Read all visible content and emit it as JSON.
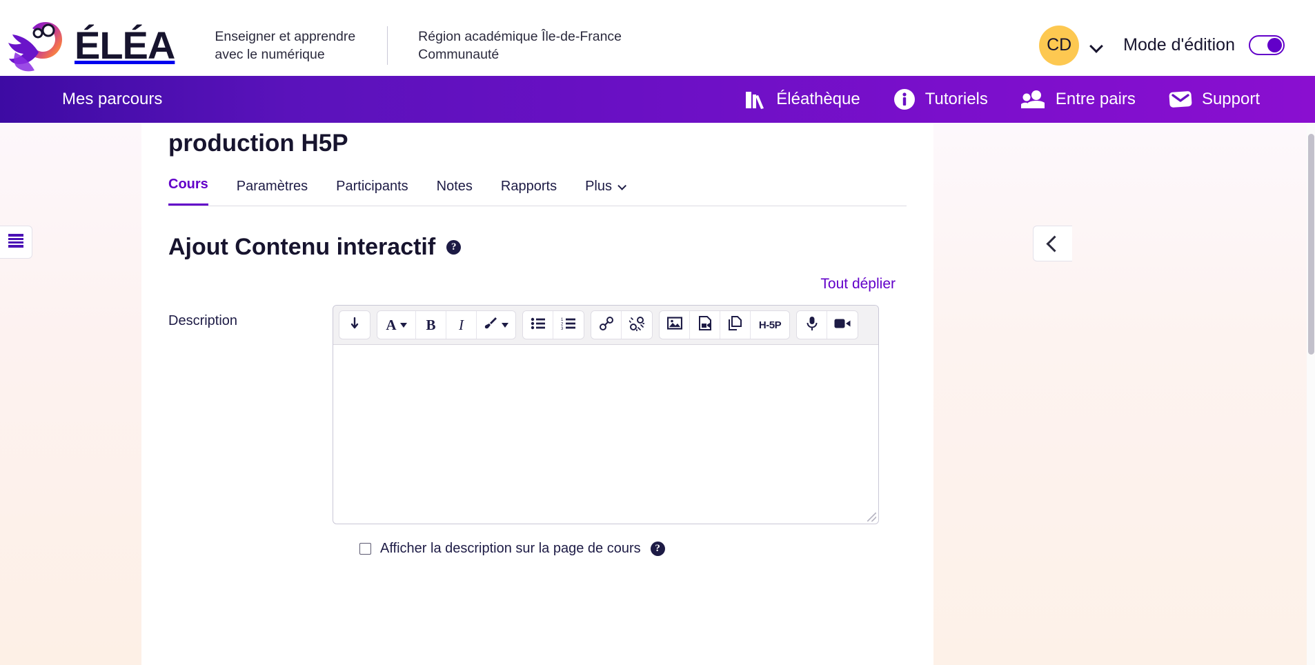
{
  "header": {
    "brand_word": "ÉLÉA",
    "logo_icon": "elea-owl-logo",
    "tagline_line1": "Enseigner et apprendre",
    "tagline_line2": "avec le numérique",
    "org_line1": "Région académique Île-de-France",
    "org_line2": "Communauté",
    "avatar_initials": "CD",
    "avatar_caret_icon": "chevron-down-icon",
    "editmode_label": "Mode d'édition",
    "editmode_on": true,
    "colors": {
      "accent": "#6200c9",
      "avatar_bg": "#fdc851",
      "nav_start": "#3d0ba3",
      "nav_end": "#8a0fd0"
    }
  },
  "nav": {
    "left_label": "Mes parcours",
    "items": [
      {
        "label": "Éléathèque",
        "icon": "books-icon"
      },
      {
        "label": "Tutoriels",
        "icon": "info-circle-icon"
      },
      {
        "label": "Entre pairs",
        "icon": "people-icon"
      },
      {
        "label": "Support",
        "icon": "envelope-icon"
      }
    ]
  },
  "course": {
    "title": "production H5P",
    "tabs": [
      {
        "label": "Cours",
        "active": true,
        "has_chevron": false
      },
      {
        "label": "Paramètres",
        "active": false,
        "has_chevron": false
      },
      {
        "label": "Participants",
        "active": false,
        "has_chevron": false
      },
      {
        "label": "Notes",
        "active": false,
        "has_chevron": false
      },
      {
        "label": "Rapports",
        "active": false,
        "has_chevron": false
      },
      {
        "label": "Plus",
        "active": false,
        "has_chevron": true
      }
    ]
  },
  "form": {
    "heading": "Ajout Contenu interactif",
    "heading_help_icon": "help-circle-icon",
    "expand_all": "Tout déplier",
    "description_label": "Description",
    "description_value": "",
    "show_description_label": "Afficher la description sur la page de cours",
    "show_description_checked": false,
    "show_description_help_icon": "help-circle-icon"
  },
  "editor_toolbar": {
    "groups": [
      {
        "buttons": [
          {
            "icon": "collapse-toolbar-icon",
            "name": "collapse-toolbar-button"
          }
        ]
      },
      {
        "buttons": [
          {
            "icon": "font-style-icon",
            "name": "font-style-button",
            "text": "A",
            "caret": true
          },
          {
            "icon": "bold-icon",
            "name": "bold-button",
            "text": "B"
          },
          {
            "icon": "italic-icon",
            "name": "italic-button",
            "text": "I"
          },
          {
            "icon": "brush-icon",
            "name": "highlight-button",
            "caret": true
          }
        ]
      },
      {
        "buttons": [
          {
            "icon": "bullet-list-icon",
            "name": "bullet-list-button"
          },
          {
            "icon": "numbered-list-icon",
            "name": "numbered-list-button"
          }
        ]
      },
      {
        "buttons": [
          {
            "icon": "link-icon",
            "name": "insert-link-button"
          },
          {
            "icon": "unlink-icon",
            "name": "remove-link-button"
          }
        ]
      },
      {
        "buttons": [
          {
            "icon": "image-icon",
            "name": "insert-image-button"
          },
          {
            "icon": "media-file-icon",
            "name": "insert-media-button"
          },
          {
            "icon": "file-copy-icon",
            "name": "manage-files-button"
          },
          {
            "icon": "h5p-icon",
            "name": "insert-h5p-button",
            "text": "H-5P"
          }
        ]
      },
      {
        "buttons": [
          {
            "icon": "microphone-icon",
            "name": "record-audio-button"
          },
          {
            "icon": "video-camera-icon",
            "name": "record-video-button"
          }
        ]
      }
    ]
  },
  "rails": {
    "left_toggle_icon": "course-index-icon",
    "right_toggle_icon": "chevron-left-icon"
  }
}
